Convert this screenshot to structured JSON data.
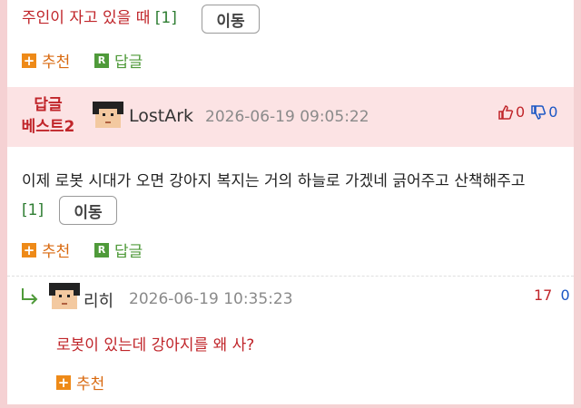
{
  "top_comment": {
    "text_prefix": "주인이 자고 있을 때 ",
    "reply_count": "[1]",
    "move_label": "이동",
    "recommend_label": "추천",
    "reply_label": "답글"
  },
  "best_comment": {
    "best_line1": "답글",
    "best_line2": "베스트2",
    "username": "LostArk",
    "timestamp": "2026-06-19 09:05:22",
    "likes": "0",
    "dislikes": "0",
    "body": "이제 로봇 시대가 오면 강아지 복지는 거의 하늘로 가겠네 긁어주고 산책해주고",
    "reply_count": "[1]",
    "move_label": "이동",
    "recommend_label": "추천",
    "reply_label": "답글"
  },
  "reply": {
    "username": "리히",
    "timestamp": "2026-06-19 10:35:23",
    "likes": "17",
    "dislikes": "0",
    "body": "로봇이 있는데 강아지를 왜 사?",
    "recommend_label": "추천"
  },
  "icons": [
    "plus-icon",
    "reply-r-icon",
    "thumbs-up-icon",
    "thumbs-down-icon",
    "reply-arrow-icon",
    "avatar-icon"
  ],
  "colors": {
    "page_border": "#f5d1d3",
    "best_bg": "#fce3e4",
    "best_label": "#c0252a",
    "accent_orange": "#ee8a18",
    "accent_green": "#4f9a3a",
    "reply_text": "#c0252a",
    "count_green": "#2e7d32",
    "count_blue": "#1a56c4"
  }
}
